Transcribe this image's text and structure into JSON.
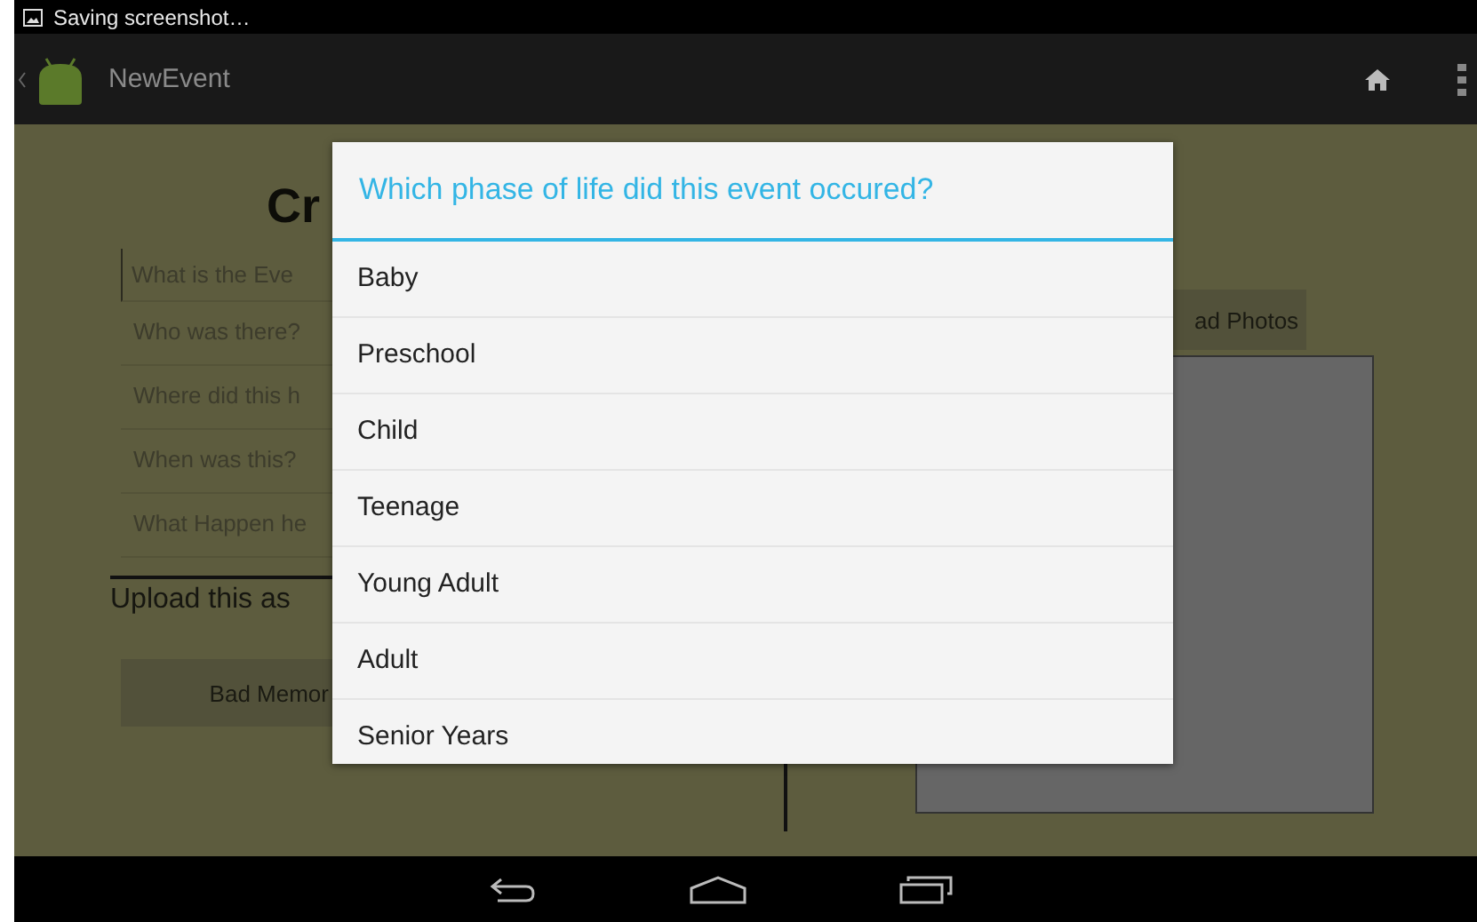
{
  "status_bar": {
    "notification": "Saving screenshot…"
  },
  "action_bar": {
    "title": "NewEvent"
  },
  "form": {
    "heading": "Cr",
    "fields": [
      {
        "placeholder": "What is the Eve"
      },
      {
        "placeholder": "Who was there?"
      },
      {
        "placeholder": "Where did this h"
      },
      {
        "placeholder": "When was this?"
      },
      {
        "placeholder": "What Happen he"
      }
    ],
    "upload_label": "Upload this as",
    "memory_button": "Bad Memor",
    "photos_button": "ad Photos"
  },
  "dialog": {
    "title": "Which phase of life did this event occured?",
    "items": [
      {
        "label": "Baby"
      },
      {
        "label": "Preschool"
      },
      {
        "label": "Child"
      },
      {
        "label": "Teenage"
      },
      {
        "label": "Young Adult"
      },
      {
        "label": "Adult"
      },
      {
        "label": "Senior Years"
      }
    ]
  }
}
